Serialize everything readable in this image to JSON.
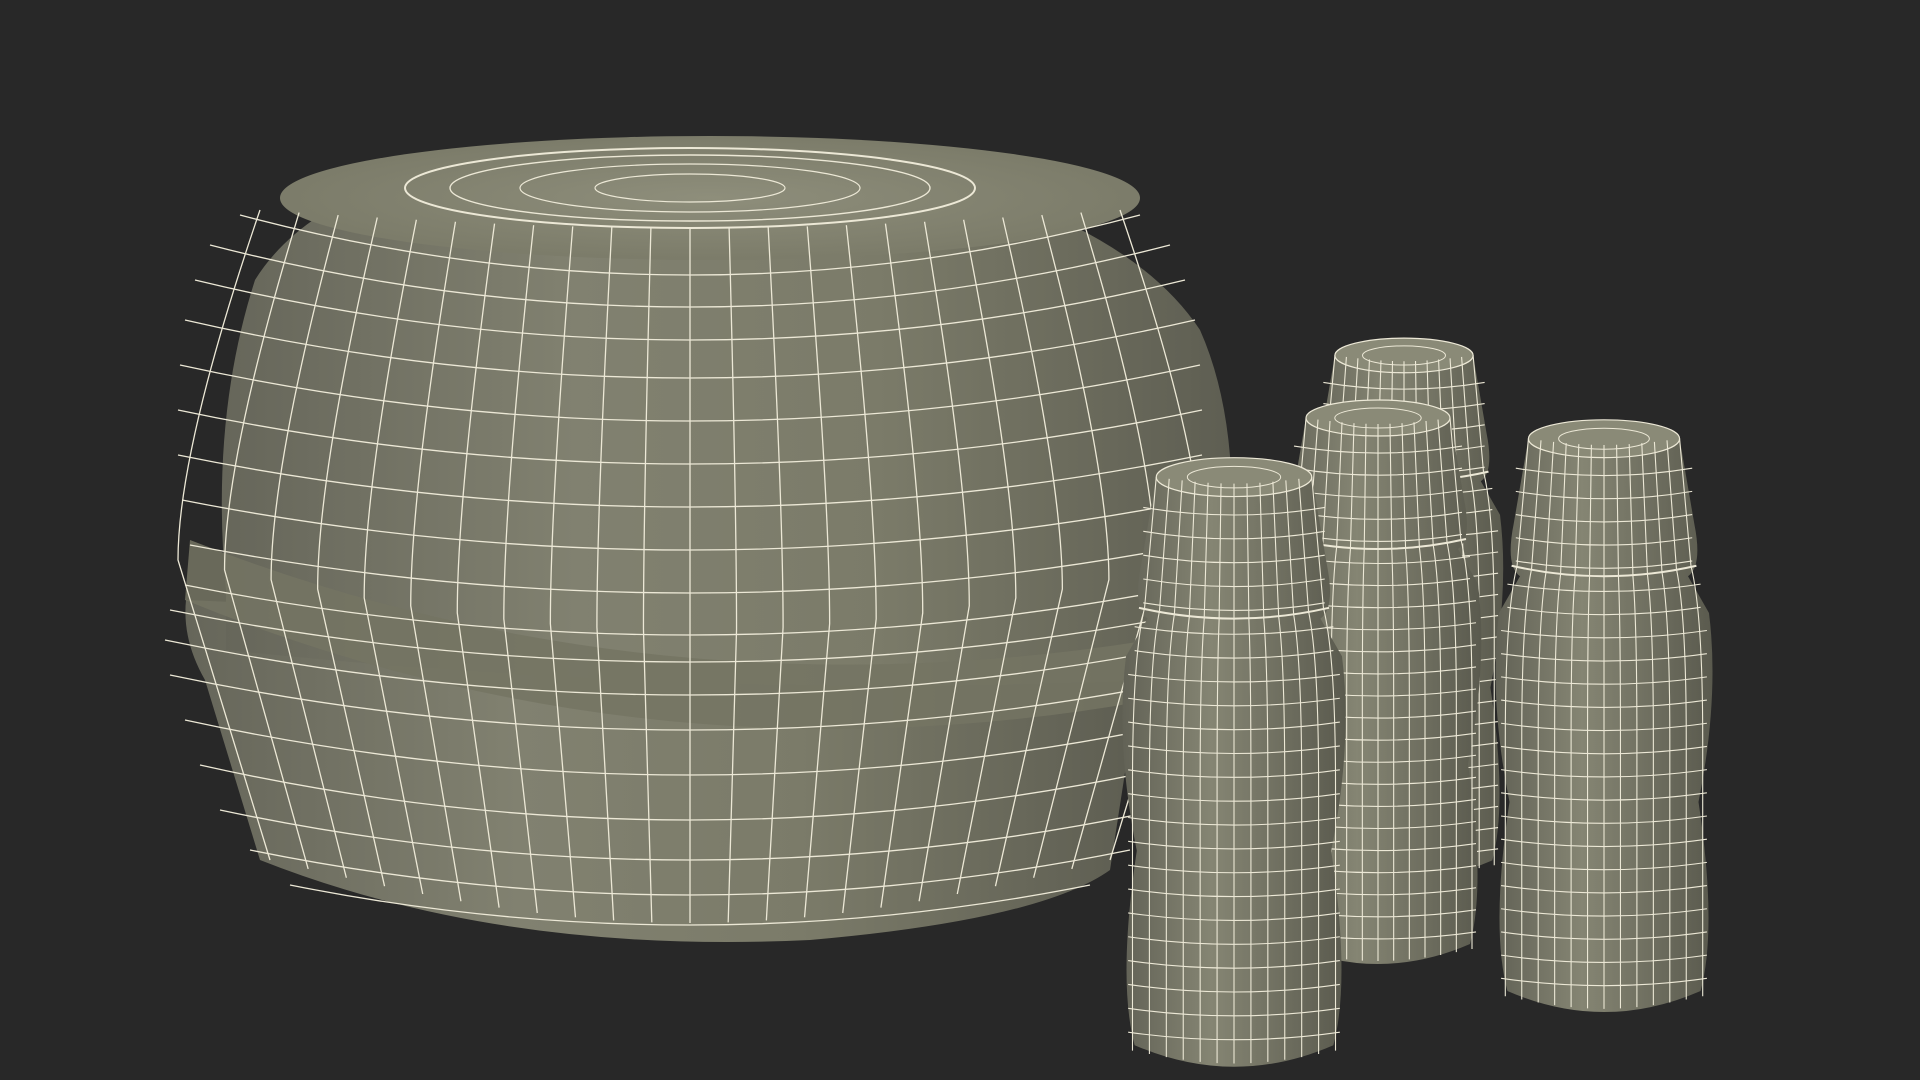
{
  "scene": {
    "render_style": "wireframe-on-shaded",
    "colors": {
      "background": "#282828",
      "surface_light": "#8a8a76",
      "surface_mid": "#7b7b69",
      "surface_dark": "#5d5d4f",
      "wire": "#ece8d6"
    },
    "objects": [
      {
        "name": "round-container",
        "kind": "lidded-bowl"
      },
      {
        "name": "bottle-back-left",
        "kind": "small-bottle"
      },
      {
        "name": "bottle-back-middle",
        "kind": "small-bottle"
      },
      {
        "name": "bottle-right",
        "kind": "small-bottle"
      },
      {
        "name": "bottle-front",
        "kind": "small-bottle"
      }
    ]
  }
}
